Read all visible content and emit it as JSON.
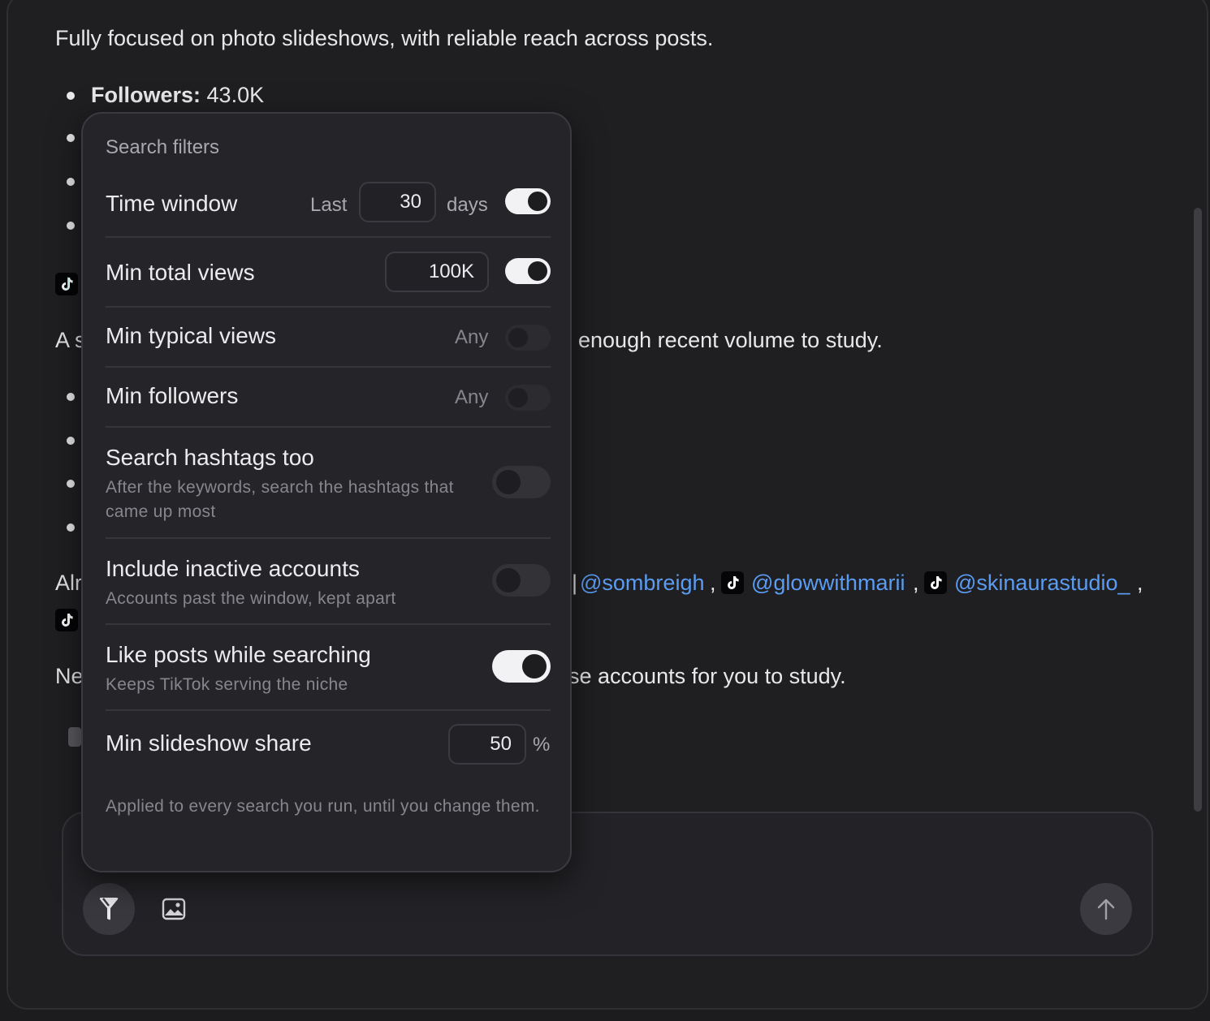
{
  "chat": {
    "intro": "Fully focused on photo slideshows, with reliable reach across posts.",
    "followers_label": "Followers:",
    "followers_value": "43.0K",
    "para2_start": "A s",
    "para2_end": "enough recent volume to study.",
    "para3_start": "Alr",
    "mention_1": "@sombreigh",
    "mention_2": "@glowwithmarii",
    "mention_3": "@skinaurastudio_",
    "para4_start": "Ne",
    "para4_end": "se accounts for you to study."
  },
  "filters": {
    "title": "Search filters",
    "time_window": {
      "label": "Time window",
      "prefix": "Last",
      "value": "30",
      "unit": "days",
      "enabled": true
    },
    "min_total_views": {
      "label": "Min total views",
      "value": "100K",
      "enabled": true
    },
    "min_typical_views": {
      "label": "Min typical views",
      "value": "Any",
      "enabled": false
    },
    "min_followers": {
      "label": "Min followers",
      "value": "Any",
      "enabled": false
    },
    "search_hashtags": {
      "label": "Search hashtags too",
      "description": "After the keywords, search the hashtags that came up most",
      "enabled": false
    },
    "include_inactive": {
      "label": "Include inactive accounts",
      "description": "Accounts past the window, kept apart",
      "enabled": false
    },
    "like_posts": {
      "label": "Like posts while searching",
      "description": "Keeps TikTok serving the niche",
      "enabled": true
    },
    "min_slideshow_share": {
      "label": "Min slideshow share",
      "value": "50",
      "unit": "%"
    },
    "footer": "Applied to every search you run, until you change them."
  },
  "composer": {
    "filter_icon": "filter-icon",
    "image_icon": "image-icon",
    "send_icon": "arrow-up-icon"
  },
  "colors": {
    "background": "#1f1f22",
    "link": "#5b9cf2",
    "toggle_on": "#f2f2f4"
  }
}
